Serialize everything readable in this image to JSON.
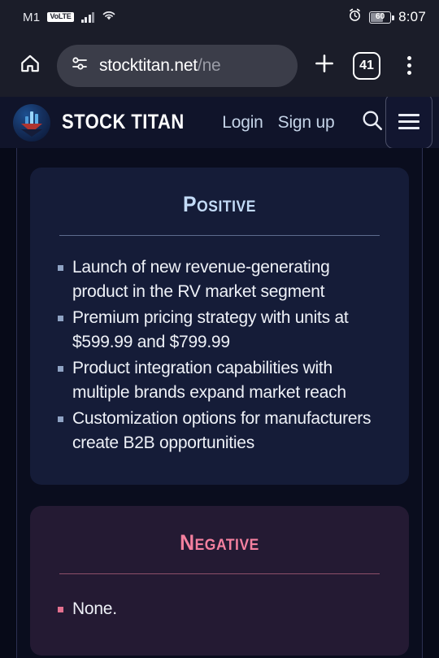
{
  "status_bar": {
    "carrier": "M1",
    "volte": "VoLTE",
    "signal_icon": "signal-bars-icon",
    "wifi_icon": "wifi-icon",
    "alarm_icon": "alarm-clock-icon",
    "battery_level": "60",
    "time": "8:07"
  },
  "browser": {
    "home_icon": "home-icon",
    "site_settings_icon": "page-settings-icon",
    "url_host": "stocktitan.net",
    "url_path": "/ne",
    "new_tab_icon": "plus-icon",
    "tab_count": "41",
    "menu_icon": "kebab-menu-icon"
  },
  "site_header": {
    "logo_icon": "stock-titan-logo-icon",
    "brand": "STOCK TITAN",
    "login": "Login",
    "signup": "Sign up",
    "search_icon": "search-icon",
    "hamburger_icon": "hamburger-menu-icon"
  },
  "cards": {
    "positive": {
      "title": "Positive",
      "accent": "#c3dbf7",
      "background": "#151c38",
      "bullets": [
        "Launch of new revenue-generating product in the RV market segment",
        "Premium pricing strategy with units at $599.99 and $799.99",
        "Product integration capabilities with multiple brands expand market reach",
        "Customization options for manufacturers create B2B opportunities"
      ]
    },
    "negative": {
      "title": "Negative",
      "accent": "#f4809f",
      "background": "#241a33",
      "bullets": [
        "None."
      ]
    }
  }
}
